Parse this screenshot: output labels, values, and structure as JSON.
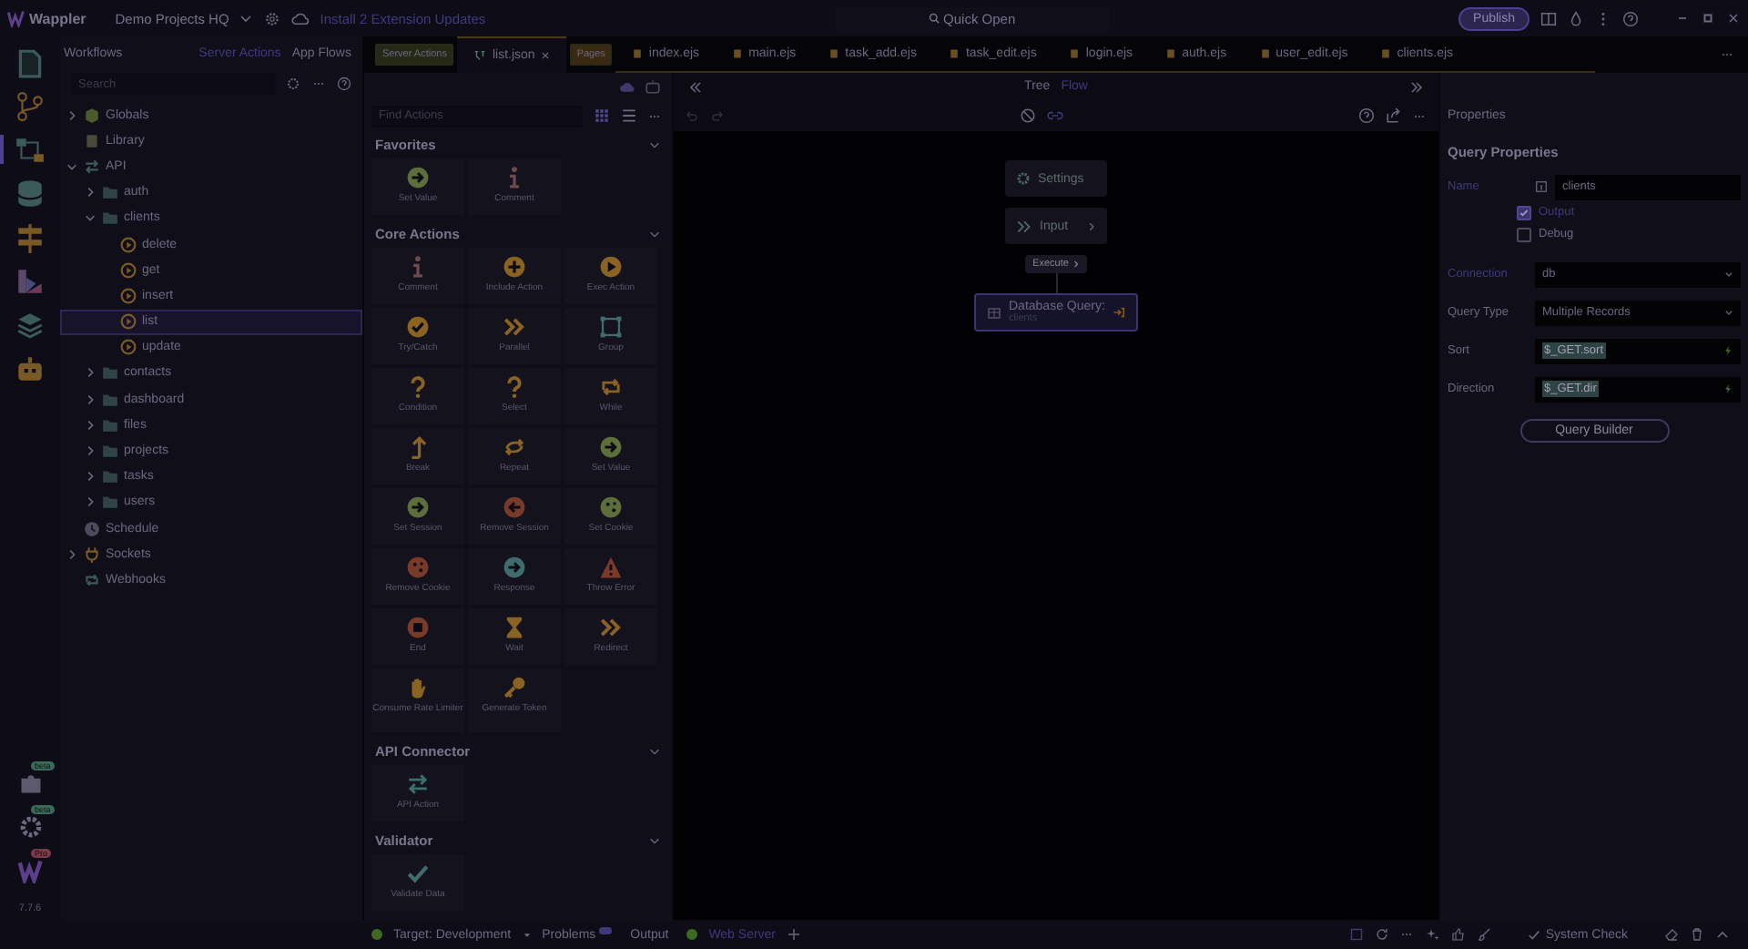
{
  "app": {
    "name": "Wappler",
    "project": "Demo Projects HQ",
    "update_notice": "Install 2 Extension Updates",
    "quick_open": "Quick Open",
    "publish": "Publish",
    "version": "7.7.6"
  },
  "activity_bar": {
    "items": [
      {
        "kind": "pages",
        "selected": false
      },
      {
        "kind": "git",
        "selected": false
      },
      {
        "kind": "server",
        "selected": true
      },
      {
        "kind": "database",
        "selected": false
      },
      {
        "kind": "resources",
        "selected": false
      },
      {
        "kind": "design",
        "selected": false
      },
      {
        "kind": "layers",
        "selected": false
      },
      {
        "kind": "robot",
        "selected": false
      }
    ],
    "bottom": [
      {
        "kind": "extensions",
        "badge": "beta"
      },
      {
        "kind": "settings",
        "badge": "beta"
      },
      {
        "kind": "logo",
        "badge": "Pro"
      }
    ]
  },
  "workflows": {
    "title": "Workflows",
    "tabs": [
      {
        "label": "Server Actions",
        "selected": true
      },
      {
        "label": "App Flows",
        "selected": false
      }
    ],
    "search_placeholder": "Search",
    "tree": [
      {
        "label": "Globals",
        "kind": "globals",
        "expanded": false,
        "selected": false
      },
      {
        "label": "Library",
        "kind": "library",
        "selected": false
      },
      {
        "label": "API",
        "kind": "api",
        "expanded": true,
        "selected": false,
        "children": [
          {
            "label": "auth",
            "kind": "folder",
            "expanded": false,
            "selected": false
          },
          {
            "label": "clients",
            "kind": "folder",
            "expanded": true,
            "selected": false,
            "children": [
              {
                "label": "delete",
                "kind": "action",
                "selected": false
              },
              {
                "label": "get",
                "kind": "action",
                "selected": false
              },
              {
                "label": "insert",
                "kind": "action",
                "selected": false
              },
              {
                "label": "list",
                "kind": "action",
                "selected": true
              },
              {
                "label": "update",
                "kind": "action",
                "selected": false
              }
            ]
          },
          {
            "label": "contacts",
            "kind": "folder",
            "expanded": false,
            "selected": false
          },
          {
            "label": "dashboard",
            "kind": "folder",
            "expanded": false,
            "selected": false
          },
          {
            "label": "files",
            "kind": "folder",
            "expanded": false,
            "selected": false
          },
          {
            "label": "projects",
            "kind": "folder",
            "expanded": false,
            "selected": false
          },
          {
            "label": "tasks",
            "kind": "folder",
            "expanded": false,
            "selected": false
          },
          {
            "label": "users",
            "kind": "folder",
            "expanded": false,
            "selected": false
          }
        ]
      },
      {
        "label": "Schedule",
        "kind": "schedule",
        "selected": false
      },
      {
        "label": "Sockets",
        "kind": "sockets",
        "expanded": false,
        "selected": false
      },
      {
        "label": "Webhooks",
        "kind": "webhooks",
        "selected": false
      }
    ]
  },
  "editor_tabs": [
    {
      "label": "Server Actions",
      "kind": "group",
      "selected": false
    },
    {
      "label": "list.json",
      "kind": "flow",
      "selected": true
    },
    {
      "label": "Pages",
      "kind": "group",
      "selected": false
    },
    {
      "label": "index.ejs",
      "kind": "page",
      "selected": false
    },
    {
      "label": "main.ejs",
      "kind": "page",
      "selected": false
    },
    {
      "label": "task_add.ejs",
      "kind": "page",
      "selected": false
    },
    {
      "label": "task_edit.ejs",
      "kind": "page",
      "selected": false
    },
    {
      "label": "login.ejs",
      "kind": "page",
      "selected": false
    },
    {
      "label": "auth.ejs",
      "kind": "page",
      "selected": false
    },
    {
      "label": "user_edit.ejs",
      "kind": "page",
      "selected": false
    },
    {
      "label": "clients.ejs",
      "kind": "page",
      "selected": false
    }
  ],
  "actions_panel": {
    "search_placeholder": "Find Actions",
    "sections": [
      {
        "title": "Favorites",
        "expanded": true,
        "items": [
          {
            "label": "Set Value",
            "kind": "arrow-right",
            "color": "#5d6e3a"
          },
          {
            "label": "Comment",
            "kind": "info",
            "color": "#6e4a4e"
          }
        ]
      },
      {
        "title": "Core Actions",
        "expanded": true,
        "items": [
          {
            "label": "Comment",
            "kind": "info",
            "color": "#6e4a4e"
          },
          {
            "label": "Include Action",
            "kind": "plus",
            "color": "#8a6222"
          },
          {
            "label": "Exec Action",
            "kind": "play",
            "color": "#8a6222"
          },
          {
            "label": "Try/Catch",
            "kind": "check",
            "color": "#8a6222"
          },
          {
            "label": "Parallel",
            "kind": "chevrons",
            "color": "#8a6222"
          },
          {
            "label": "Group",
            "kind": "group",
            "color": "#3f6c6c"
          },
          {
            "label": "Condition",
            "kind": "question",
            "color": "#8a6222"
          },
          {
            "label": "Select",
            "kind": "question",
            "color": "#8a6222"
          },
          {
            "label": "While",
            "kind": "loop",
            "color": "#8a6222"
          },
          {
            "label": "Break",
            "kind": "arrow-up",
            "color": "#8a6222"
          },
          {
            "label": "Repeat",
            "kind": "repeat",
            "color": "#8a6222"
          },
          {
            "label": "Set Value",
            "kind": "arrow-right",
            "color": "#5d6e3a"
          },
          {
            "label": "Set Session",
            "kind": "arrow-right",
            "color": "#5d6e3a"
          },
          {
            "label": "Remove Session",
            "kind": "arrow-left",
            "color": "#7a3a28"
          },
          {
            "label": "Set Cookie",
            "kind": "cookie",
            "color": "#5d6e3a"
          },
          {
            "label": "Remove Cookie",
            "kind": "cookie",
            "color": "#7a3a28"
          },
          {
            "label": "Response",
            "kind": "arrow-right",
            "color": "#3f6c6c"
          },
          {
            "label": "Throw Error",
            "kind": "warning",
            "color": "#7a3a28"
          },
          {
            "label": "End",
            "kind": "stop",
            "color": "#7a3a28"
          },
          {
            "label": "Wait",
            "kind": "hourglass",
            "color": "#8a6222"
          },
          {
            "label": "Redirect",
            "kind": "chevrons",
            "color": "#8a6222"
          },
          {
            "label": "Consume Rate Limiter",
            "kind": "hand",
            "color": "#8a6222"
          },
          {
            "label": "Generate Token",
            "kind": "key",
            "color": "#8a6222"
          }
        ]
      },
      {
        "title": "API Connector",
        "expanded": true,
        "items": [
          {
            "label": "API Action",
            "kind": "swap",
            "color": "#3f6c6c"
          }
        ]
      },
      {
        "title": "Validator",
        "expanded": true,
        "items": [
          {
            "label": "Validate Data",
            "kind": "tick",
            "color": "#3f6c6c"
          }
        ]
      }
    ]
  },
  "flow": {
    "view_tabs": [
      {
        "label": "Tree",
        "selected": false
      },
      {
        "label": "Flow",
        "selected": true
      }
    ],
    "settings_node": "Settings",
    "input_node": "Input",
    "execute_label": "Execute",
    "step": {
      "title": "Database Query:",
      "subtitle": "clients",
      "selected": true
    }
  },
  "properties": {
    "title": "Properties",
    "heading": "Query Properties",
    "name": {
      "label": "Name",
      "value": "clients",
      "required": true
    },
    "options": [
      {
        "label": "Output",
        "checked": true
      },
      {
        "label": "Debug",
        "checked": false
      }
    ],
    "fields": [
      {
        "label": "Connection",
        "kind": "select",
        "value": "db",
        "required": true
      },
      {
        "label": "Query Type",
        "kind": "select",
        "value": "Multiple Records",
        "required": false
      },
      {
        "label": "Sort",
        "kind": "expression",
        "value": "$_GET.sort",
        "required": false
      },
      {
        "label": "Direction",
        "kind": "expression",
        "value": "$_GET.dir",
        "required": false
      }
    ],
    "button": "Query Builder"
  },
  "status_bar": {
    "target": "Target: Development",
    "problems": "Problems",
    "output": "Output",
    "server": "Web Server",
    "system_check": "System Check"
  }
}
